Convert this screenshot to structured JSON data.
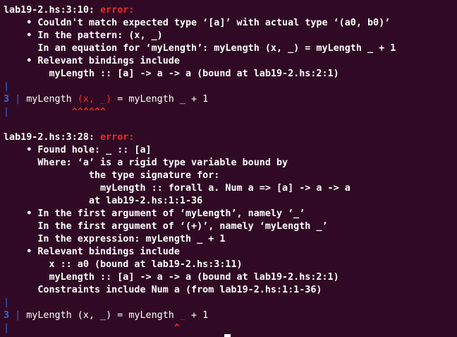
{
  "terminal": {
    "error1": {
      "location": "lab19-2.hs:3:10: ",
      "label": "error:",
      "lines": [
        "    • Couldn't match expected type ‘[a]’ with actual type ‘(a0, b0)’",
        "    • In the pattern: (x, _)",
        "      In an equation for ‘myLength’: myLength (x, _) = myLength _ + 1",
        "    • Relevant bindings include",
        "        myLength :: [a] -> a -> a (bound at lab19-2.hs:2:1)"
      ],
      "src_line_no": "3",
      "src_pre": "myLength ",
      "src_hl": "(x, _)",
      "src_post": " = myLength _ + 1",
      "caret_pad": "         ",
      "caret": "^^^^^^"
    },
    "error2": {
      "location": "lab19-2.hs:3:28: ",
      "label": "error:",
      "lines": [
        "    • Found hole: _ :: [a]",
        "      Where: ‘a’ is a rigid type variable bound by",
        "               the type signature for:",
        "                 myLength :: forall a. Num a => [a] -> a -> a",
        "               at lab19-2.hs:1:1-36",
        "    • In the first argument of ‘myLength’, namely ‘_’",
        "      In the first argument of ‘(+)’, namely ‘myLength _’",
        "      In the expression: myLength _ + 1",
        "    • Relevant bindings include",
        "        x :: a0 (bound at lab19-2.hs:3:11)",
        "        myLength :: [a] -> a -> a (bound at lab19-2.hs:2:1)",
        "      Constraints include Num a (from lab19-2.hs:1:1-36)"
      ],
      "src_line_no": "3",
      "src_pre": "myLength (x, _) = myLength ",
      "src_hl": "_",
      "src_post": " + 1",
      "caret_pad": "                           ",
      "caret": "^"
    },
    "gutter_bar": "|",
    "colors": {
      "background": "#300a24",
      "error_red": "#ef2929",
      "gutter_blue": "#3465e4",
      "text": "#ffffff"
    }
  }
}
